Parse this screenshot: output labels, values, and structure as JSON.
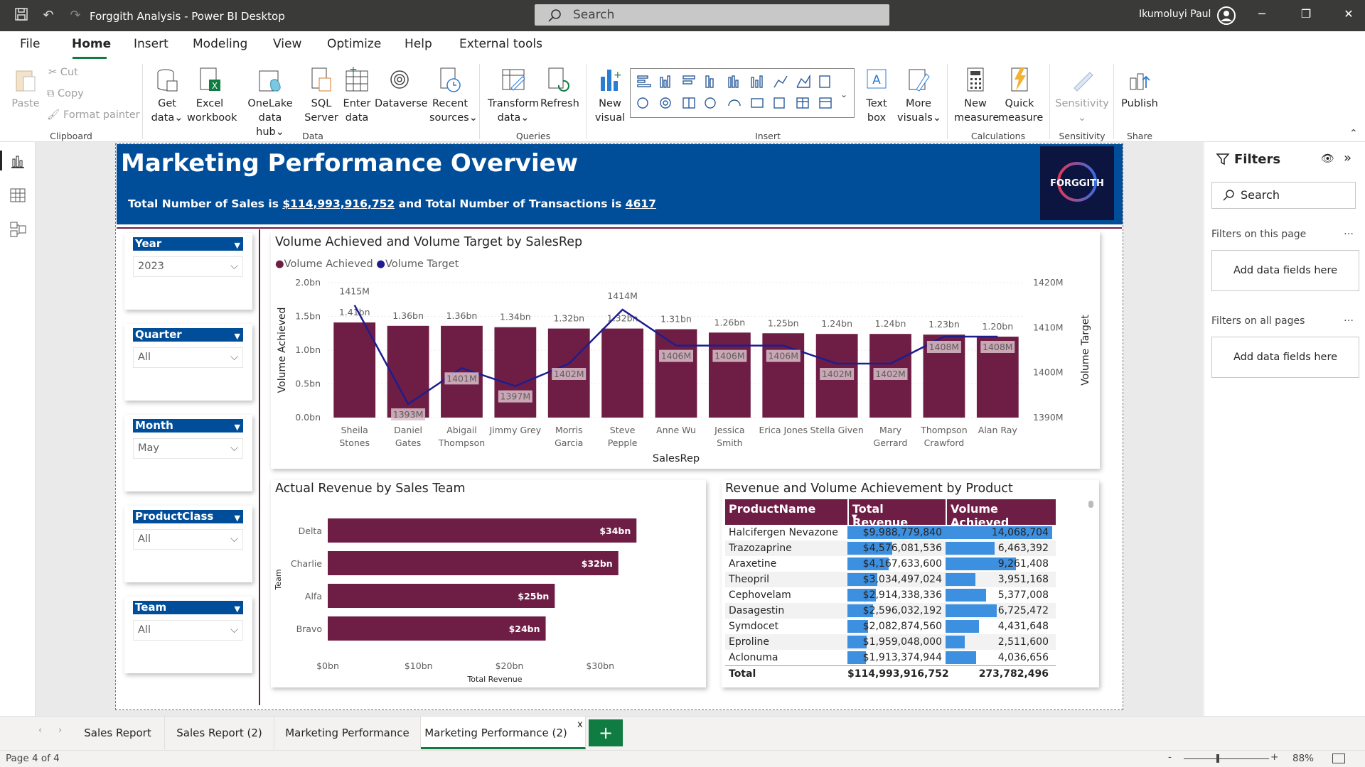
{
  "app": {
    "title": "Forggith Analysis - Power BI Desktop",
    "search_placeholder": "Search",
    "user": "Ikumoluyi Paul"
  },
  "menu": [
    "File",
    "Home",
    "Insert",
    "Modeling",
    "View",
    "Optimize",
    "Help",
    "External tools"
  ],
  "ribbon": {
    "clipboard": {
      "paste": "Paste",
      "cut": "Cut",
      "copy": "Copy",
      "format_painter": "Format painter",
      "group": "Clipboard"
    },
    "data": {
      "get_data": [
        "Get",
        "data"
      ],
      "excel": [
        "Excel",
        "workbook"
      ],
      "onelake": [
        "OneLake data",
        "hub"
      ],
      "sql": [
        "SQL",
        "Server"
      ],
      "enter": [
        "Enter",
        "data"
      ],
      "dataverse": "Dataverse",
      "recent": [
        "Recent",
        "sources"
      ],
      "group": "Data"
    },
    "queries": {
      "transform": [
        "Transform",
        "data"
      ],
      "refresh": "Refresh",
      "group": "Queries"
    },
    "insert": {
      "new_visual": [
        "New",
        "visual"
      ],
      "text_box": [
        "Text",
        "box"
      ],
      "more_visuals": [
        "More",
        "visuals"
      ],
      "group": "Insert"
    },
    "calculations": {
      "new_measure": [
        "New",
        "measure"
      ],
      "quick_measure": [
        "Quick",
        "measure"
      ],
      "group": "Calculations"
    },
    "sensitivity": {
      "label": "Sensitivity",
      "group": "Sensitivity"
    },
    "share": {
      "publish": "Publish",
      "group": "Share"
    }
  },
  "report": {
    "title": "Marketing Performance Overview",
    "subtitle_pre": "Total Number of Sales is ",
    "total_sales": "$114,993,916,752",
    "subtitle_mid": " and Total Number of Transactions is ",
    "transactions": "4617",
    "logo_text": "FORGGITH"
  },
  "slicers": [
    {
      "label": "Year",
      "value": "2023"
    },
    {
      "label": "Quarter",
      "value": "All"
    },
    {
      "label": "Month",
      "value": "May"
    },
    {
      "label": "ProductClass",
      "value": "All"
    },
    {
      "label": "Team",
      "value": "All"
    }
  ],
  "chart_data": [
    {
      "type": "bar",
      "title": "Volume Achieved and Volume Target by SalesRep",
      "legend": [
        "Volume Achieved",
        "Volume Target"
      ],
      "xlabel": "SalesRep",
      "ylabel": "Volume Achieved",
      "y2label": "Volume Target",
      "colors": {
        "Volume Achieved": "#6e1e45",
        "Volume Target": "#1d1d8f"
      },
      "categories": [
        [
          "Sheila",
          "Stones"
        ],
        [
          "Daniel",
          "Gates"
        ],
        [
          "Abigail",
          "Thompson"
        ],
        [
          "Jimmy Grey"
        ],
        [
          "Morris",
          "Garcia"
        ],
        [
          "Steve",
          "Pepple"
        ],
        [
          "Anne Wu"
        ],
        [
          "Jessica",
          "Smith"
        ],
        [
          "Erica Jones"
        ],
        [
          "Stella Given"
        ],
        [
          "Mary",
          "Gerrard"
        ],
        [
          "Thompson",
          "Crawford"
        ],
        [
          "Alan Ray"
        ]
      ],
      "series": [
        {
          "name": "Volume Achieved",
          "axis": "left",
          "values": [
            1.41,
            1.36,
            1.36,
            1.34,
            1.32,
            1.32,
            1.31,
            1.26,
            1.25,
            1.24,
            1.24,
            1.23,
            1.2
          ],
          "labels": [
            "1.41bn",
            "1.36bn",
            "1.36bn",
            "1.34bn",
            "1.32bn",
            "1.32bn",
            "1.31bn",
            "1.26bn",
            "1.25bn",
            "1.24bn",
            "1.24bn",
            "1.23bn",
            "1.20bn"
          ]
        },
        {
          "name": "Volume Target",
          "axis": "right",
          "values": [
            1415,
            1393,
            1401,
            1397,
            1402,
            1414,
            1406,
            1406,
            1406,
            1402,
            1402,
            1408,
            1408
          ],
          "labels": [
            "1415M",
            "1393M",
            "1401M",
            "1397M",
            "1402M",
            "1414M",
            "1406M",
            "1406M",
            "1406M",
            "1402M",
            "1402M",
            "1408M",
            "1408M"
          ]
        }
      ],
      "ylim": [
        0,
        2
      ],
      "yticks": [
        "0.0bn",
        "0.5bn",
        "1.0bn",
        "1.5bn",
        "2.0bn"
      ],
      "y2lim": [
        1390,
        1420
      ],
      "y2ticks": [
        "1390M",
        "1400M",
        "1410M",
        "1420M"
      ]
    },
    {
      "type": "bar",
      "orientation": "horizontal",
      "title": "Actual Revenue by Sales Team",
      "categories": [
        "Delta",
        "Charlie",
        "Alfa",
        "Bravo"
      ],
      "values": [
        34,
        32,
        25,
        24
      ],
      "labels": [
        "$34bn",
        "$32bn",
        "$25bn",
        "$24bn"
      ],
      "xlabel": "Total Revenue",
      "ylabel": "Team",
      "xlim": [
        0,
        34
      ],
      "xticks": [
        "$0bn",
        "$10bn",
        "$20bn",
        "$30bn"
      ],
      "color": "#6e1e45"
    },
    {
      "type": "table",
      "title": "Revenue and Volume Achievement by Product",
      "columns": [
        "ProductName",
        "Total Revenue",
        "Volume Achieved"
      ],
      "rows": [
        [
          "Halcifergen Nevazone",
          "$9,988,779,840",
          "14,068,704"
        ],
        [
          "Trazozaprine",
          "$4,576,081,536",
          "6,463,392"
        ],
        [
          "Araxetine",
          "$4,167,633,600",
          "9,261,408"
        ],
        [
          "Theopril",
          "$3,034,497,024",
          "3,951,168"
        ],
        [
          "Cephovelam",
          "$2,914,338,336",
          "5,377,008"
        ],
        [
          "Dasagestin",
          "$2,596,032,192",
          "6,725,472"
        ],
        [
          "Symdocet",
          "$2,082,874,560",
          "4,431,648"
        ],
        [
          "Eproline",
          "$1,959,048,000",
          "2,511,600"
        ],
        [
          "Aclonuma",
          "$1,913,374,944",
          "4,036,656"
        ]
      ],
      "total": [
        "Total",
        "$114,993,916,752",
        "273,782,496"
      ],
      "revenue_values": [
        9988779840,
        4576081536,
        4167633600,
        3034497024,
        2914338336,
        2596032192,
        2082874560,
        1959048000,
        1913374944
      ],
      "volume_values": [
        14068704,
        6463392,
        9261408,
        3951168,
        5377008,
        6725472,
        4431648,
        2511600,
        4036656
      ]
    }
  ],
  "filters": {
    "title": "Filters",
    "search": "Search",
    "this_page": "Filters on this page",
    "all_pages": "Filters on all pages",
    "add_fields": "Add data fields here"
  },
  "tabs": [
    "Sales Report",
    "Sales Report (2)",
    "Marketing Performance",
    "Marketing Performance (2)"
  ],
  "status": {
    "page": "Page 4 of 4",
    "zoom": "88%"
  }
}
